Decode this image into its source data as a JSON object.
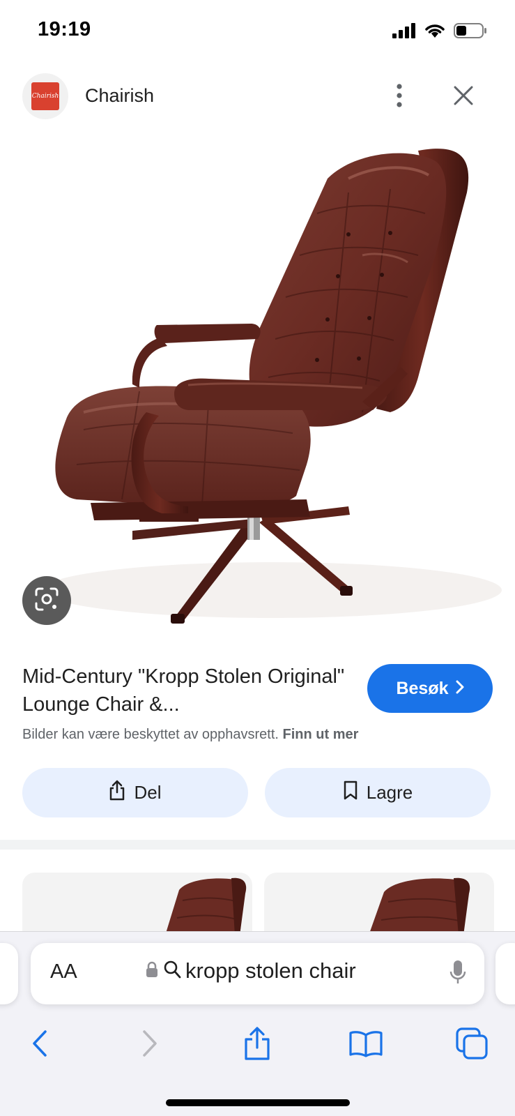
{
  "status_bar": {
    "time": "19:19"
  },
  "header": {
    "source_name": "Chairish",
    "logo_text": "Chairish"
  },
  "result": {
    "title": "Mid-Century \"Kropp Stolen Original\" Lounge Chair &...",
    "visit_label": "Besøk",
    "copyright_notice": "Bilder kan være beskyttet av opphavsrett.",
    "learn_more": "Finn ut mer"
  },
  "actions": {
    "share_label": "Del",
    "save_label": "Lagre"
  },
  "safari": {
    "aa_label": "AA",
    "search_query": "kropp stolen chair"
  },
  "colors": {
    "accent": "#1a73e8",
    "chip_bg": "#e8f0fe",
    "leather": "#6b2a22"
  },
  "icons": [
    "signal-icon",
    "wifi-icon",
    "battery-icon",
    "more-vertical-icon",
    "close-icon",
    "lens-icon",
    "chevron-right-icon",
    "share-icon",
    "bookmark-icon",
    "lock-icon",
    "search-icon",
    "mic-icon",
    "back-icon",
    "forward-icon",
    "bookmarks-icon",
    "tabs-icon"
  ]
}
